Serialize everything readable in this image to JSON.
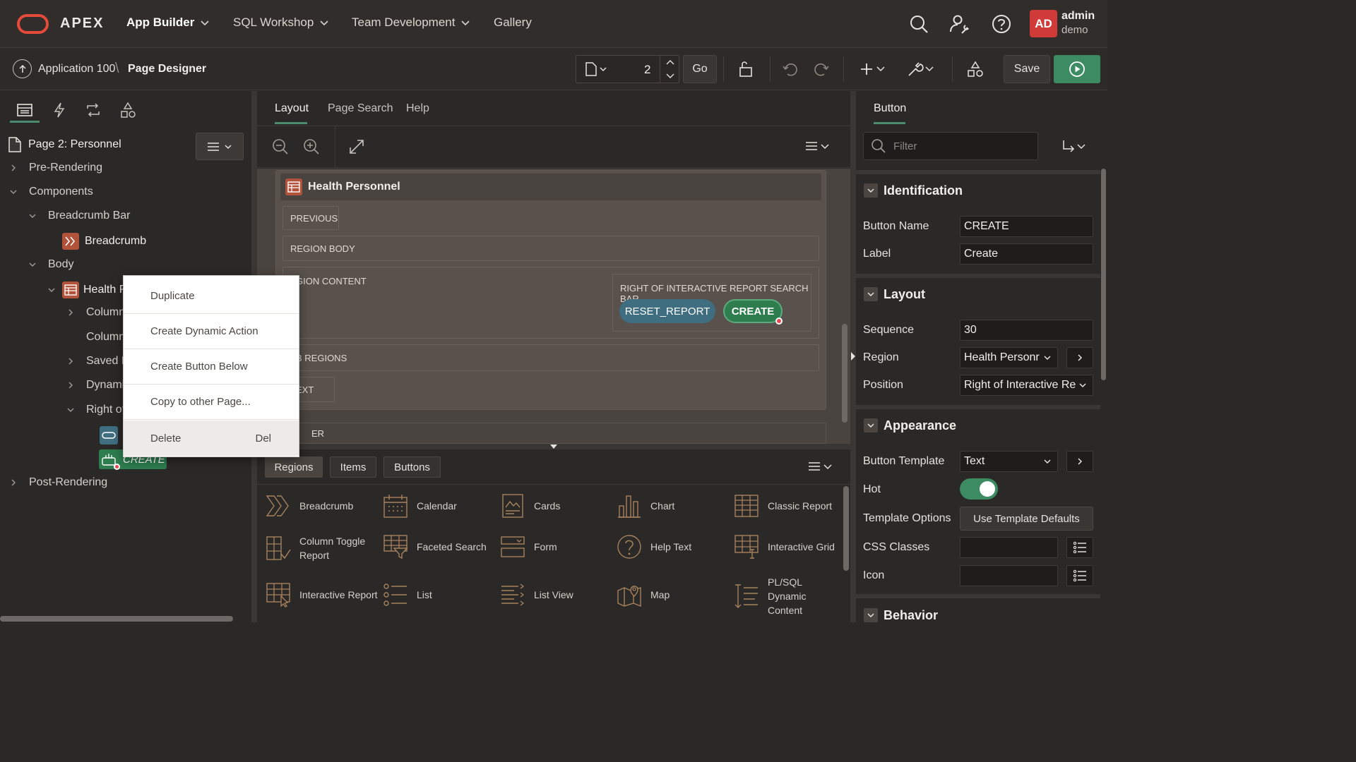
{
  "app": {
    "brand": "APEX",
    "brand_color": "#e54b3a",
    "nav": [
      {
        "label": "App Builder",
        "active": true
      },
      {
        "label": "SQL Workshop",
        "active": false
      },
      {
        "label": "Team Development",
        "active": false
      },
      {
        "label": "Gallery",
        "active": false
      }
    ],
    "user": {
      "initials": "AD",
      "name": "admin",
      "workspace": "demo",
      "avatar_color": "#d03a39"
    }
  },
  "toolbar": {
    "breadcrumb_app": "Application 100",
    "breadcrumb_page": "Page Designer",
    "page_number": "2",
    "go_label": "Go",
    "save_label": "Save"
  },
  "left_panel": {
    "page_label": "Page 2: Personnel",
    "tree": {
      "pre_rendering": "Pre-Rendering",
      "components": "Components",
      "breadcrumb_bar": "Breadcrumb Bar",
      "breadcrumb": "Breadcrumb",
      "body": "Body",
      "health_region": "Health P",
      "columns_1": "Column",
      "columns_2": "Column",
      "saved_reports": "Saved R",
      "dynamic": "Dynami",
      "right_of": "Right of",
      "create_button": "CREATE",
      "post_rendering": "Post-Rendering"
    }
  },
  "context_menu": {
    "items": [
      {
        "label": "Duplicate",
        "shortcut": ""
      },
      {
        "label": "Create Dynamic Action",
        "shortcut": ""
      },
      {
        "label": "Create Button Below",
        "shortcut": ""
      },
      {
        "label": "Copy to other Page...",
        "shortcut": ""
      },
      {
        "label": "Delete",
        "shortcut": "Del"
      }
    ]
  },
  "center": {
    "tabs": [
      "Layout",
      "Page Search",
      "Help"
    ],
    "layout": {
      "region_title": "Health Personnel",
      "previous": "PREVIOUS",
      "region_body": "REGION BODY",
      "region_content": "GION CONTENT",
      "right_of_search": "RIGHT OF INTERACTIVE REPORT SEARCH BAR",
      "reset_button": "RESET_REPORT",
      "create_button": "CREATE",
      "sub_regions": "B REGIONS",
      "next": "EXT",
      "footer": "ER"
    },
    "gallery_tabs": [
      "Regions",
      "Items",
      "Buttons"
    ],
    "gallery": [
      {
        "label": "Breadcrumb",
        "icon": "breadcrumb-icon"
      },
      {
        "label": "Calendar",
        "icon": "calendar-icon"
      },
      {
        "label": "Cards",
        "icon": "cards-icon"
      },
      {
        "label": "Chart",
        "icon": "chart-icon"
      },
      {
        "label": "Classic Report",
        "icon": "classic-report-icon"
      },
      {
        "label": "Column Toggle Report",
        "icon": "column-toggle-icon"
      },
      {
        "label": "Faceted Search",
        "icon": "faceted-search-icon"
      },
      {
        "label": "Form",
        "icon": "form-icon"
      },
      {
        "label": "Help Text",
        "icon": "help-text-icon"
      },
      {
        "label": "Interactive Grid",
        "icon": "interactive-grid-icon"
      },
      {
        "label": "Interactive Report",
        "icon": "interactive-report-icon"
      },
      {
        "label": "List",
        "icon": "list-icon"
      },
      {
        "label": "List View",
        "icon": "list-view-icon"
      },
      {
        "label": "Map",
        "icon": "map-icon"
      },
      {
        "label": "PL/SQL Dynamic Content",
        "icon": "plsql-icon"
      }
    ]
  },
  "right_panel": {
    "tab": "Button",
    "filter_placeholder": "Filter",
    "groups": {
      "identification": "Identification",
      "layout": "Layout",
      "appearance": "Appearance",
      "behavior": "Behavior"
    },
    "props": {
      "button_name_label": "Button Name",
      "button_name": "CREATE",
      "label_label": "Label",
      "label": "Create",
      "sequence_label": "Sequence",
      "sequence": "30",
      "region_label": "Region",
      "region": "Health Personr",
      "position_label": "Position",
      "position": "Right of Interactive Re",
      "template_label": "Button Template",
      "template": "Text",
      "hot_label": "Hot",
      "hot": true,
      "template_options_label": "Template Options",
      "template_options_button": "Use Template Defaults",
      "css_classes_label": "CSS Classes",
      "icon_label": "Icon"
    }
  },
  "colors": {
    "accent_green": "#3c8b62",
    "reset_button": "#3e6e80",
    "create_button": "#2e7d4f",
    "region_icon": "#b0533a"
  }
}
